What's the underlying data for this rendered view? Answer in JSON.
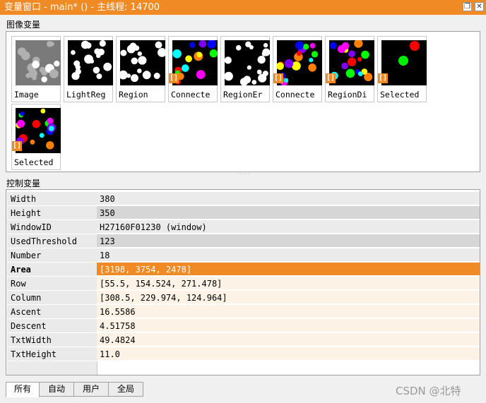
{
  "window": {
    "title": "变量窗口 - main* () - 主线程: 14700",
    "restore_icon": "restore-icon",
    "close_icon": "close-icon"
  },
  "image_section": {
    "label": "图像变量",
    "thumbnails": [
      {
        "label": "Image",
        "kind": "gray"
      },
      {
        "label": "LightReg",
        "kind": "binary"
      },
      {
        "label": "Region",
        "kind": "binary"
      },
      {
        "label": "Connecte",
        "kind": "color",
        "badge": "[]"
      },
      {
        "label": "RegionEr",
        "kind": "binary"
      },
      {
        "label": "Connecte",
        "kind": "color",
        "badge": "[]"
      },
      {
        "label": "RegionDi",
        "kind": "color",
        "badge": "[]"
      },
      {
        "label": "Selected",
        "kind": "selected",
        "badge": "[]"
      },
      {
        "label": "Selected",
        "kind": "color",
        "badge": "[]"
      }
    ]
  },
  "control_section": {
    "label": "控制变量",
    "rows": [
      {
        "name": "Width",
        "value": "380"
      },
      {
        "name": "Height",
        "value": "350"
      },
      {
        "name": "WindowID",
        "value": "H27160F01230 (window)"
      },
      {
        "name": "UsedThreshold",
        "value": "123"
      },
      {
        "name": "Number",
        "value": "18"
      },
      {
        "name": "Area",
        "value": "[3198, 3754, 2478]"
      },
      {
        "name": "Row",
        "value": "[55.5, 154.524, 271.478]"
      },
      {
        "name": "Column",
        "value": "[308.5, 229.974, 124.964]"
      },
      {
        "name": "Ascent",
        "value": "16.5586"
      },
      {
        "name": "Descent",
        "value": "4.51758"
      },
      {
        "name": "TxtWidth",
        "value": "49.4824"
      },
      {
        "name": "TxtHeight",
        "value": "11.0"
      }
    ],
    "selected_row": "Area"
  },
  "tabs": [
    "所有",
    "自动",
    "用户",
    "全局"
  ],
  "active_tab": "所有",
  "watermark": "CSDN @北特",
  "colors": {
    "accent": "#f08a24",
    "row_selected": "#f08a24",
    "row_peach": "#fdf2e6"
  }
}
